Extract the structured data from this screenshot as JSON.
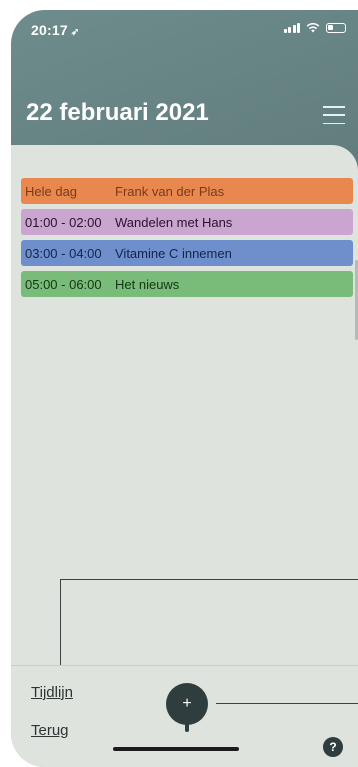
{
  "status_bar": {
    "time": "20:17",
    "location_glyph": "➶"
  },
  "header": {
    "title": "22 februari 2021"
  },
  "events": [
    {
      "time": "Hele dag",
      "name": "Frank van der Plas",
      "bg": "#e8874e",
      "text_color": "#7a3a18"
    },
    {
      "time": "01:00 - 02:00",
      "name": "Wandelen met Hans",
      "bg": "#c9a5cf",
      "text_color": "#2b1230"
    },
    {
      "time": "03:00 - 04:00",
      "name": "Vitamine C innemen",
      "bg": "#6f8fcc",
      "text_color": "#15244a"
    },
    {
      "time": "05:00 - 06:00",
      "name": "Het nieuws",
      "bg": "#79bb78",
      "text_color": "#163516"
    }
  ],
  "bottom_nav": {
    "timeline_label": "Tijdlijn",
    "back_label": "Terug",
    "add_label": "+",
    "help_label": "?"
  },
  "icons": [
    "location-arrow-icon",
    "signal-icon",
    "wifi-icon",
    "battery-icon",
    "hamburger-menu-icon",
    "plus-icon",
    "help-icon"
  ]
}
